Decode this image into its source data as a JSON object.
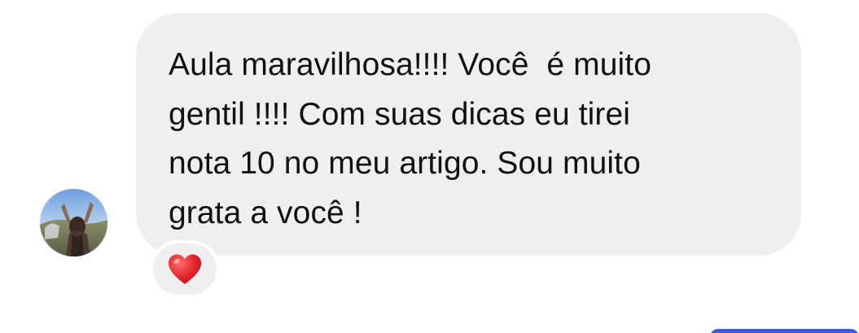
{
  "conversation": {
    "avatar_icon": "user-avatar-photo",
    "message": {
      "lines": [
        "Aula maravilhosa!!!! Você  é muito",
        "gentil !!!! Com suas dicas eu tirei",
        "nota 10 no meu artigo. Sou muito",
        "grata a você !"
      ],
      "bubble_color": "#efeff0",
      "text_color": "#111111"
    },
    "reaction": {
      "icon": "red-heart-icon",
      "color": "#e0242c"
    }
  }
}
